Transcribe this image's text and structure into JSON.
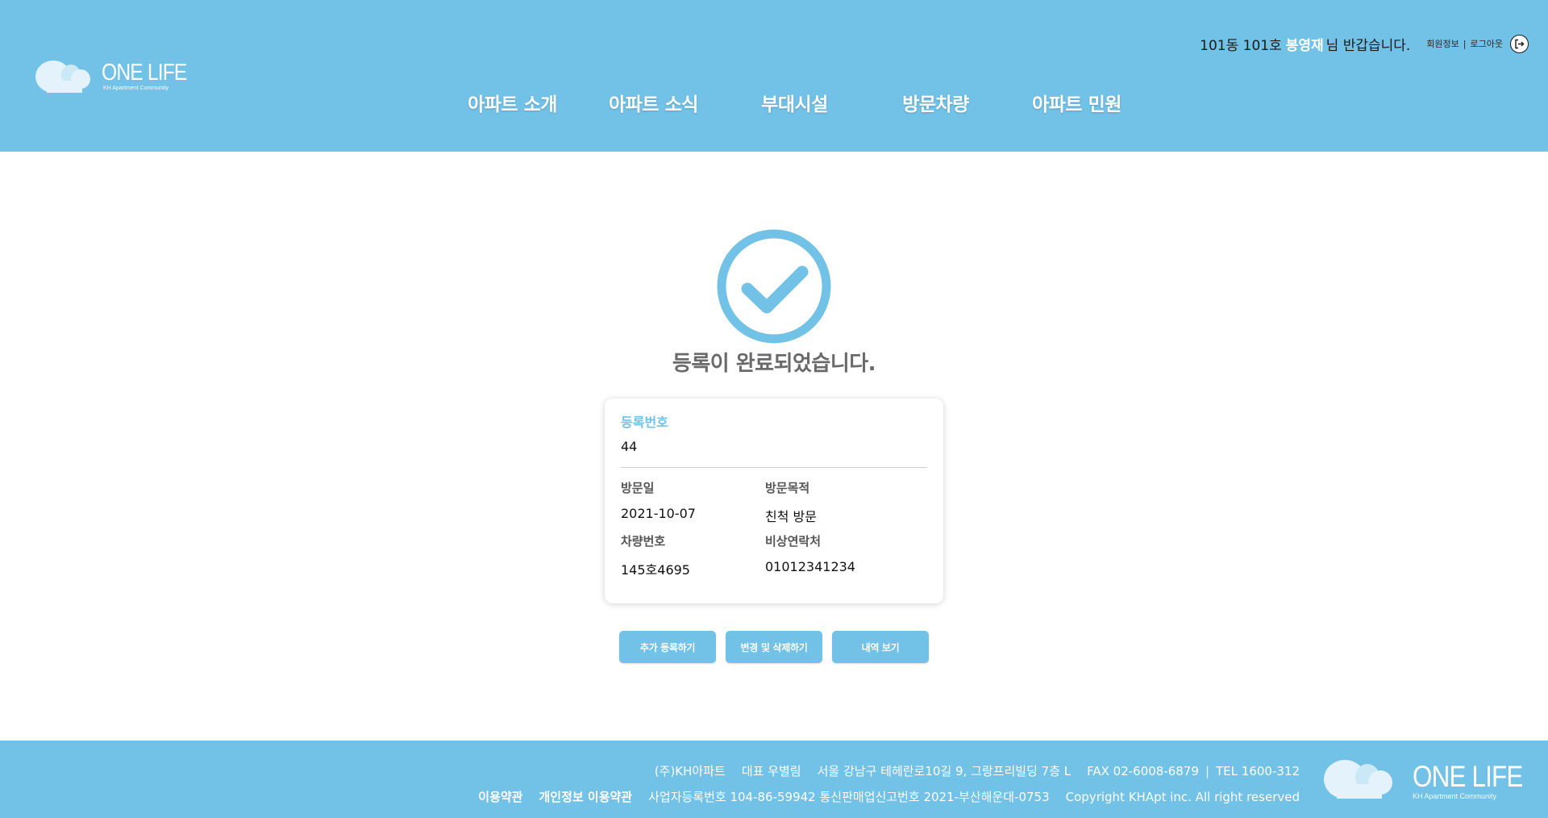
{
  "brand": {
    "name": "ONE LIFE",
    "tagline": "KH Apartment Community",
    "color": "#72c1e6"
  },
  "header": {
    "greeting_prefix": "101동 101호",
    "user_name": "봉영재",
    "greeting_suffix": "님 반갑습니다.",
    "member_info_label": "회원정보",
    "logout_label": "로그아웃",
    "nav": [
      {
        "label": "아파트 소개"
      },
      {
        "label": "아파트 소식"
      },
      {
        "label": "부대시설"
      },
      {
        "label": "방문차량"
      },
      {
        "label": "아파트 민원"
      }
    ]
  },
  "main": {
    "status_icon": "check-circle-icon",
    "title": "등록이 완료되었습니다.",
    "card": {
      "reg_no_label": "등록번호",
      "reg_no_value": "44",
      "visit_date_label": "방문일",
      "visit_date_value": "2021-10-07",
      "purpose_label": "방문목적",
      "purpose_value": "친척 방문",
      "car_no_label": "차량번호",
      "car_no_value": "145호4695",
      "emergency_label": "비상연락처",
      "emergency_value": "01012341234"
    },
    "buttons": {
      "add": "추가 등록하기",
      "edit_delete": "변경 및 삭제하기",
      "history": "내역 보기"
    }
  },
  "footer": {
    "company": "(주)KH아파트",
    "ceo": "대표 우별림",
    "address": "서울 강남구 테헤란로10길 9, 그랑프리빌딩 7층 L",
    "fax": "FAX 02-6008-6879",
    "tel": "TEL 1600-312",
    "terms_link": "이용약관",
    "privacy_link": "개인정보 이용약관",
    "business_info": "사업자등록번호 104-86-59942 통신판매업신고번호 2021-부산해운대-0753",
    "copyright": "Copyright KHApt inc. All right reserved"
  }
}
